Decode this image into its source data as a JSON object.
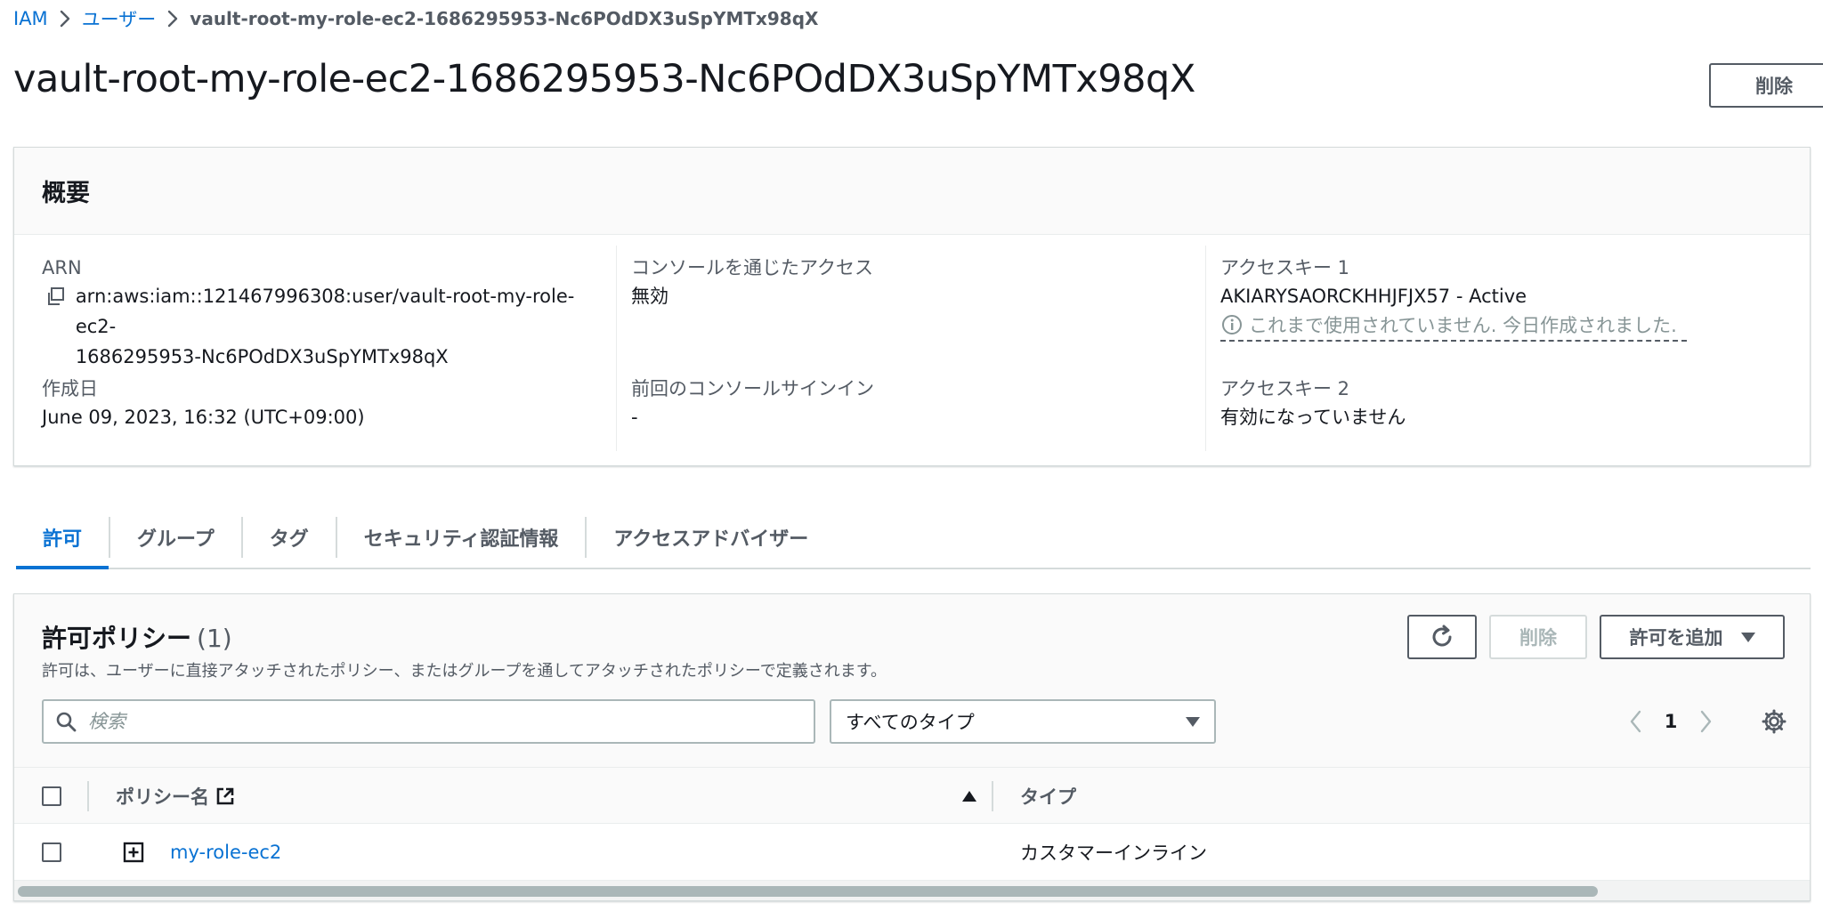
{
  "breadcrumb": {
    "items": [
      "IAM",
      "ユーザー"
    ],
    "current": "vault-root-my-role-ec2-1686295953-Nc6POdDX3uSpYMTx98qX"
  },
  "header": {
    "title": "vault-root-my-role-ec2-1686295953-Nc6POdDX3uSpYMTx98qX",
    "delete_label": "削除"
  },
  "summary": {
    "heading": "概要",
    "arn_label": "ARN",
    "arn_line1": "arn:aws:iam::121467996308:user/vault-root-my-role-ec2-",
    "arn_line2": "1686295953-Nc6POdDX3uSpYMTx98qX",
    "created_label": "作成日",
    "created_value": "June 09, 2023, 16:32 (UTC+09:00)",
    "console_access_label": "コンソールを通じたアクセス",
    "console_access_value": "無効",
    "last_signin_label": "前回のコンソールサインイン",
    "last_signin_value": "-",
    "access_key1_label": "アクセスキー 1",
    "access_key1_value": "AKIARYSAORCKHHJFJX57 - Active",
    "access_key1_note": "これまで使用されていません. 今日作成されました.",
    "access_key2_label": "アクセスキー 2",
    "access_key2_value": "有効になっていません"
  },
  "tabs": [
    {
      "label": "許可",
      "active": true
    },
    {
      "label": "グループ",
      "active": false
    },
    {
      "label": "タグ",
      "active": false
    },
    {
      "label": "セキュリティ認証情報",
      "active": false
    },
    {
      "label": "アクセスアドバイザー",
      "active": false
    }
  ],
  "policies": {
    "title": "許可ポリシー",
    "count": "(1)",
    "description": "許可は、ユーザーに直接アタッチされたポリシー、またはグループを通してアタッチされたポリシーで定義されます。",
    "delete_label": "削除",
    "add_label": "許可を追加",
    "search_placeholder": "検索",
    "type_filter": "すべてのタイプ",
    "page": "1",
    "columns": {
      "name": "ポリシー名",
      "type": "タイプ"
    },
    "rows": [
      {
        "name": "my-role-ec2",
        "type": "カスタマーインライン"
      }
    ]
  },
  "colors": {
    "link": "#0972d3",
    "text": "#16191f",
    "muted": "#545b64",
    "border": "#d5dbdb"
  },
  "icons": [
    "chevron-right-icon",
    "copy-icon",
    "info-icon",
    "refresh-icon",
    "caret-down-icon",
    "search-icon",
    "chevron-left-icon",
    "gear-icon",
    "external-link-icon",
    "sort-up-icon",
    "expand-icon"
  ]
}
